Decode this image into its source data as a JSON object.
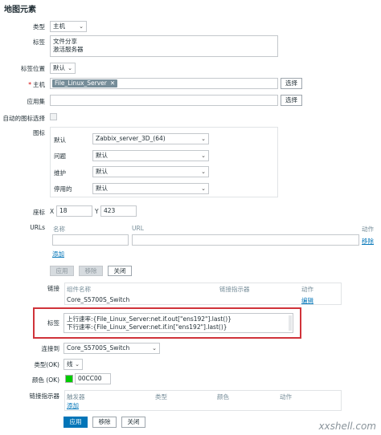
{
  "page": {
    "title": "地图元素"
  },
  "form": {
    "type": {
      "label": "类型",
      "value": "主机"
    },
    "labels": {
      "label": "标签",
      "line1": "文件分享",
      "line2": "激活服务器"
    },
    "label_pos": {
      "label": "标签位置",
      "value": "默认"
    },
    "host": {
      "label": "主机",
      "tag": "File_Linux_Server",
      "select": "选择"
    },
    "appset": {
      "label": "应用集",
      "select": "选择"
    },
    "auto_icon": {
      "label": "自动的图标选择"
    },
    "icons": {
      "label": "图标",
      "rows": [
        {
          "label": "默认",
          "value": "Zabbix_server_3D_(64)"
        },
        {
          "label": "问题",
          "value": "默认"
        },
        {
          "label": "维护",
          "value": "默认"
        },
        {
          "label": "停用的",
          "value": "默认"
        }
      ]
    },
    "coords": {
      "label": "座标",
      "x_label": "X",
      "x": "18",
      "y_label": "Y",
      "y": "423"
    },
    "urls": {
      "label": "URLs",
      "name_col": "名称",
      "url_col": "URL",
      "action_col": "动作",
      "remove": "移除",
      "add": "添加"
    },
    "buttons1": {
      "apply": "应用",
      "remove": "移除",
      "close": "关闭"
    },
    "links": {
      "label": "链接",
      "col_element": "组件名称",
      "col_indicator": "链接指示器",
      "col_action": "动作",
      "row_element": "Core_S5700S_Switch",
      "row_action": "编辑"
    },
    "link_label": {
      "label": "标签",
      "line1": "上行速率:{File_Linux_Server:net.if.out[\"ens192\"].last()}",
      "line2": "下行速率:{File_Linux_Server:net.if.in[\"ens192\"].last()}"
    },
    "connect_to": {
      "label": "连接到",
      "value": "Core_S5700S_Switch"
    },
    "type_ok": {
      "label": "类型(OK)",
      "value": "线"
    },
    "color_ok": {
      "label": "颜色 (OK)",
      "value": "00CC00",
      "swatch": "#00CC00"
    },
    "indicators": {
      "label": "链接指示器",
      "col_trigger": "触发器",
      "col_type": "类型",
      "col_color": "颜色",
      "col_action": "动作",
      "add": "添加"
    },
    "buttons2": {
      "apply": "应用",
      "remove": "移除",
      "close": "关闭"
    }
  },
  "watermark": "xxshell.com",
  "colors": {
    "primary": "#0275B8",
    "highlight": "#D0333A",
    "tag": "#768D99"
  }
}
